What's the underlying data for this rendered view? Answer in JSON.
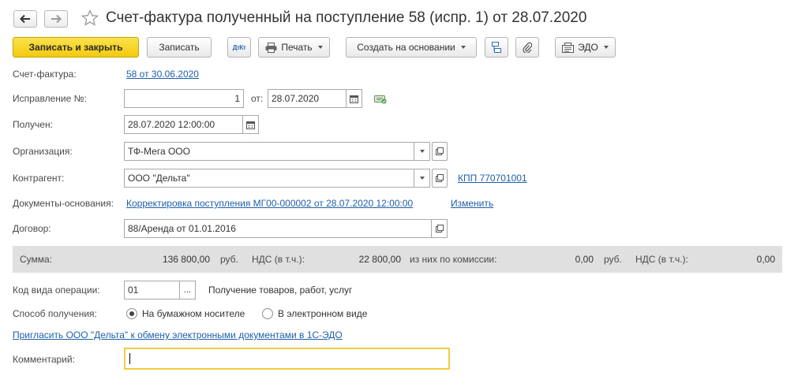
{
  "title": "Счет-фактура полученный на поступление 58 (испр. 1) от 28.07.2020",
  "toolbar": {
    "save_close": "Записать и закрыть",
    "save": "Записать",
    "dtkt": "ДтКт",
    "print": "Печать",
    "create_based": "Создать на основании",
    "edo": "ЭДО"
  },
  "form": {
    "invoice_label": "Счет-фактура:",
    "invoice_link": "58 от 30.06.2020",
    "correction_label": "Исправление №:",
    "correction_value": "1",
    "from_label": "от:",
    "from_date": "28.07.2020",
    "received_label": "Получен:",
    "received_value": "28.07.2020 12:00:00",
    "org_label": "Организация:",
    "org_value": "ТФ-Мега ООО",
    "counterparty_label": "Контрагент:",
    "counterparty_value": "ООО \"Дельта\"",
    "kpp_link": "КПП 770701001",
    "docs_label": "Документы-основания:",
    "docs_link": "Корректировка поступления МГ00-000002 от 28.07.2020 12:00:00",
    "change_link": "Изменить",
    "contract_label": "Договор:",
    "contract_value": "88/Аренда от 01.01.2016"
  },
  "summary": {
    "sum_label": "Сумма:",
    "sum_value": "136 800,00",
    "rub": "руб.",
    "vat_label": "НДС (в т.ч.):",
    "vat_value": "22 800,00",
    "commission_label": "из них по комиссии:",
    "commission_value": "0,00",
    "rub2": "руб.",
    "vat2_label": "НДС (в т.ч.):",
    "vat2_value": "0,00"
  },
  "operation": {
    "label": "Код вида операции:",
    "code": "01",
    "ellipsis": "...",
    "description": "Получение товаров, работ, услуг"
  },
  "receive": {
    "label": "Способ получения:",
    "paper": "На бумажном носителе",
    "electronic": "В электронном виде",
    "selected": "paper"
  },
  "invite_link": "Пригласить ООО \"Дельта\" к обмену электронными документами в 1С-ЭДО",
  "comment": {
    "label": "Комментарий:",
    "value": ""
  }
}
